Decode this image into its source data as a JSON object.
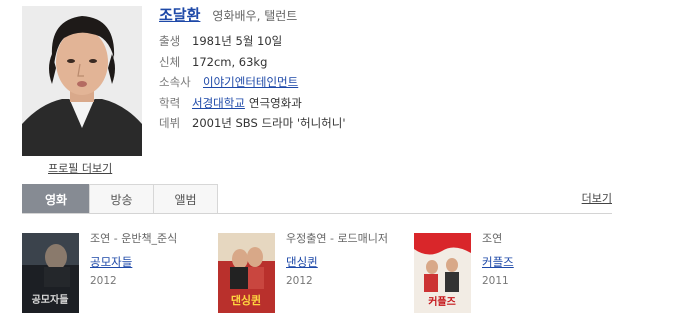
{
  "profile": {
    "name": "조달환",
    "role": "영화배우, 탤런트",
    "more_link": "프로필 더보기",
    "details": [
      {
        "key": "출생",
        "value": "1981년 5월 10일"
      },
      {
        "key": "신체",
        "value": "172cm, 63kg"
      },
      {
        "key": "소속사",
        "link": "이야기엔터테인먼트",
        "value": ""
      },
      {
        "key": "학력",
        "link": "서경대학교",
        "value": "연극영화과"
      },
      {
        "key": "데뷔",
        "value": "2001년 SBS 드라마 '허니허니'"
      }
    ]
  },
  "tabs": {
    "items": [
      {
        "label": "영화",
        "active": true
      },
      {
        "label": "방송",
        "active": false
      },
      {
        "label": "앨범",
        "active": false
      }
    ],
    "more_link": "더보기"
  },
  "films": [
    {
      "role": "조연 - 운반책_준식",
      "title": "공모자들",
      "year": "2012"
    },
    {
      "role": "우정출연 - 로드매니저",
      "title": "댄싱퀸",
      "year": "2012"
    },
    {
      "role": "조연",
      "title": "커플즈",
      "year": "2011"
    }
  ],
  "poster_text": {
    "film1": "공모자들",
    "film2": "댄싱퀸",
    "film3": "커플즈"
  }
}
